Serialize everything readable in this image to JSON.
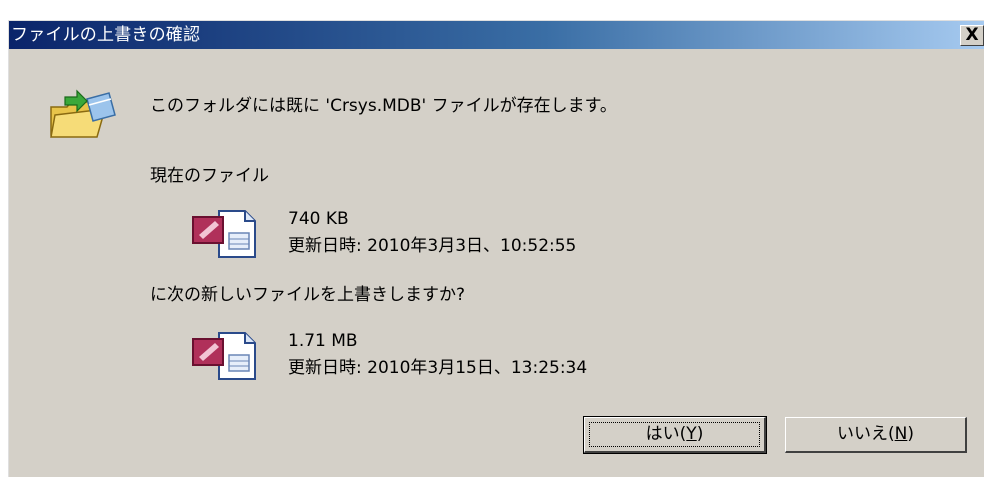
{
  "window": {
    "title": "ファイルの上書きの確認",
    "close_glyph": "X"
  },
  "message": "このフォルダには既に 'Crsys.MDB' ファイルが存在します。",
  "current_label": "現在のファイル",
  "current_file": {
    "size": "740 KB",
    "modified": "更新日時: 2010年3月3日、10:52:55"
  },
  "replace_question": "に次の新しいファイルを上書きしますか?",
  "new_file": {
    "size": "1.71 MB",
    "modified": "更新日時: 2010年3月15日、13:25:34"
  },
  "buttons": {
    "yes": {
      "text": "はい",
      "mnemonic": "Y"
    },
    "no": {
      "text": "いいえ",
      "mnemonic": "N"
    }
  },
  "icons": {
    "dialog": "folder-overwrite-icon",
    "file": "access-database-file-icon"
  },
  "colors": {
    "titlebar_start": "#0a246a",
    "titlebar_end": "#a6caf0",
    "dialog_bg": "#d4d0c8"
  }
}
